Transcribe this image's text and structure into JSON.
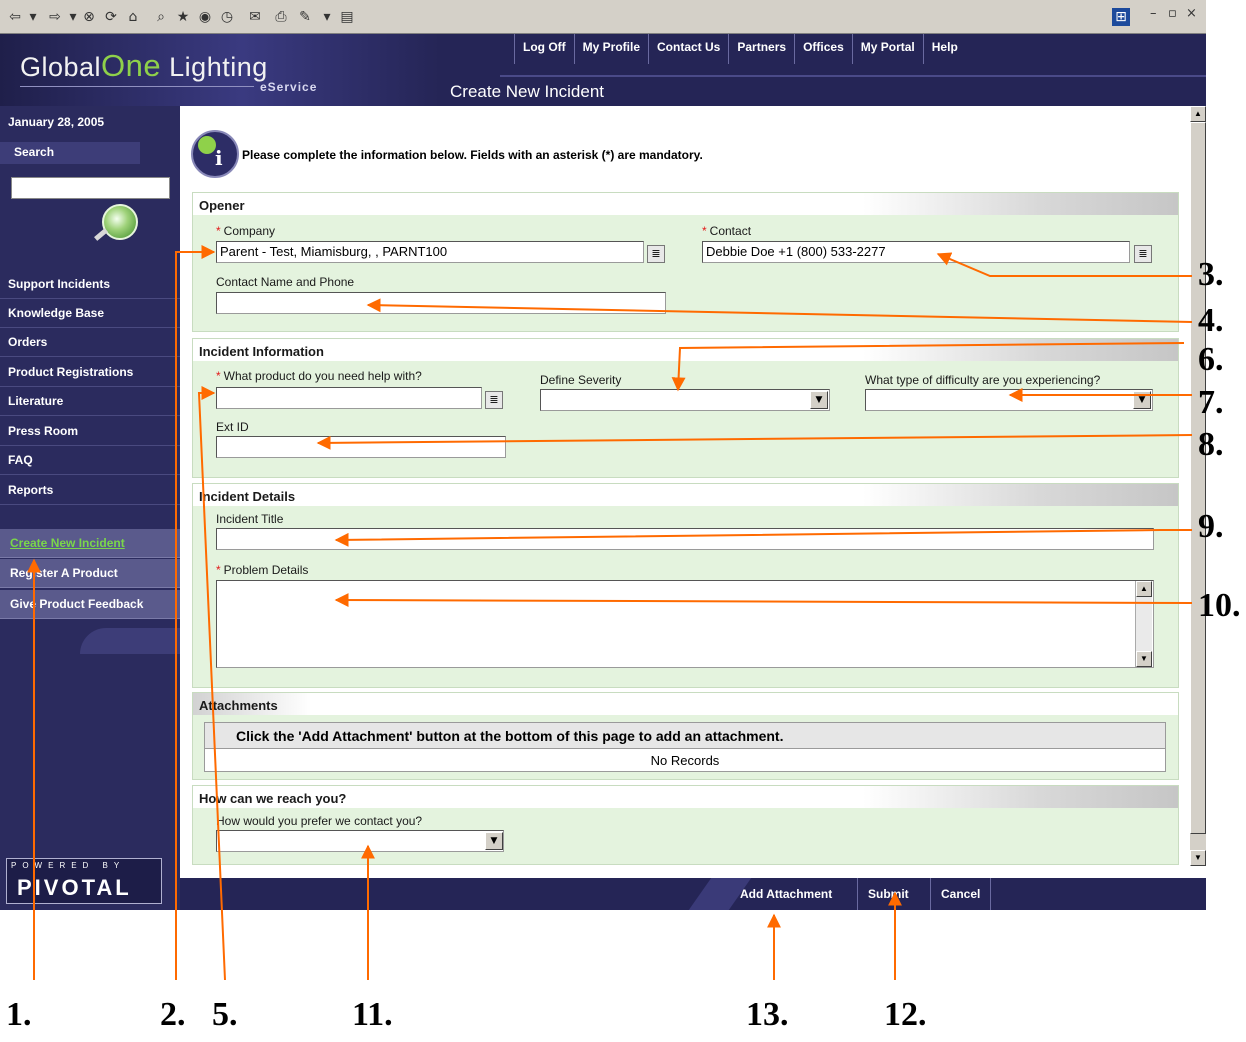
{
  "browser": {
    "toolbar_icons": [
      "back-icon",
      "forward-icon",
      "stop-icon",
      "refresh-icon",
      "home-icon",
      "search-icon",
      "favorites-icon",
      "media-icon",
      "history-icon",
      "mail-icon",
      "print-icon",
      "edit-icon",
      "discuss-icon"
    ],
    "window_controls": [
      "minimize-icon",
      "maximize-icon",
      "close-icon"
    ]
  },
  "header": {
    "brand_part1": "Global",
    "brand_part2": "One",
    "brand_part3": " Lighting",
    "brand_sub": "eService",
    "nav": [
      "Log Off",
      "My Profile",
      "Contact Us",
      "Partners",
      "Offices",
      "My Portal",
      "Help"
    ],
    "page_title": "Create New Incident"
  },
  "sidebar": {
    "date": "January 28, 2005",
    "search_label": "Search",
    "items": [
      "Support Incidents",
      "Knowledge Base",
      "Orders",
      "Product Registrations",
      "Literature",
      "Press Room",
      "FAQ",
      "Reports"
    ],
    "secondary_items": [
      "Create New Incident",
      "Register A Product",
      "Give Product Feedback"
    ],
    "powered_by": "POWERED BY",
    "logo": "PIVOTAL"
  },
  "main": {
    "instructions": "Please complete the information below. Fields with an asterisk (*) are mandatory.",
    "required_marker": "*",
    "opener": {
      "title": "Opener",
      "company_label": "Company",
      "company_value": "Parent - Test, Miamisburg, , PARNT100",
      "contact_label": "Contact",
      "contact_value": "Debbie Doe +1 (800) 533-2277",
      "contact_name_phone_label": "Contact Name and Phone",
      "contact_name_phone_value": ""
    },
    "incident_info": {
      "title": "Incident Information",
      "product_label": "What product do you need help with?",
      "severity_label": "Define Severity",
      "difficulty_label": "What type of difficulty are you experiencing?",
      "ext_id_label": "Ext ID"
    },
    "incident_details": {
      "title": "Incident Details",
      "incident_title_label": "Incident Title",
      "problem_details_label": "Problem Details"
    },
    "attachments": {
      "title": "Attachments",
      "instruction": "Click the 'Add Attachment' button at the bottom of this page to add an attachment.",
      "empty": "No Records"
    },
    "reach": {
      "title": "How can we reach you?",
      "contact_pref_label": "How would you prefer we contact you?"
    }
  },
  "footer": {
    "buttons": [
      "Add Attachment",
      "Submit",
      "Cancel"
    ]
  },
  "annotations": {
    "color": "#ff6a00",
    "callouts": [
      "1.",
      "2.",
      "5.",
      "11.",
      "13.",
      "12.",
      "3.",
      "4.",
      "6.",
      "7.",
      "8.",
      "9.",
      "10."
    ]
  }
}
